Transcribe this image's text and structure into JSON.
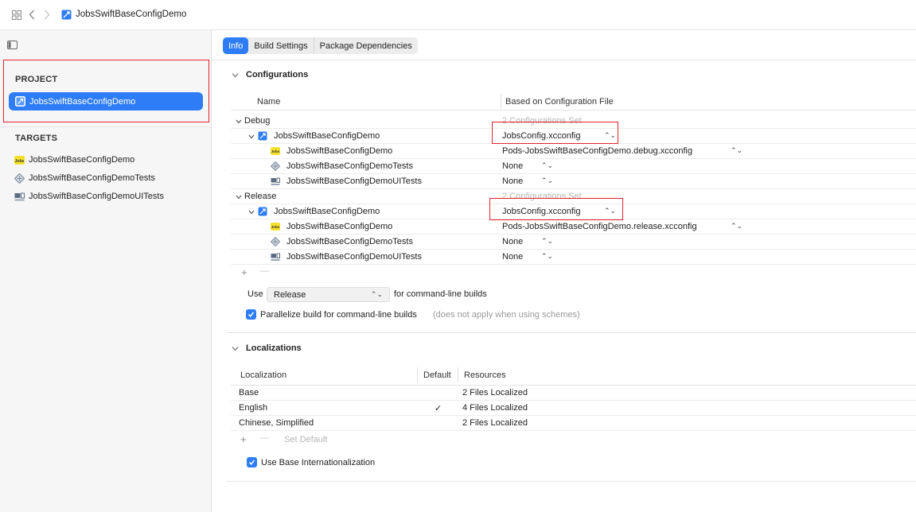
{
  "window": {
    "title": "JobsSwiftBaseConfigDemo"
  },
  "sidebar": {
    "project_header": "PROJECT",
    "project_item": "JobsSwiftBaseConfigDemo",
    "targets_header": "TARGETS",
    "targets": [
      {
        "label": "JobsSwiftBaseConfigDemo",
        "icon": "jobs-app-icon"
      },
      {
        "label": "JobsSwiftBaseConfigDemoTests",
        "icon": "unit-test-icon"
      },
      {
        "label": "JobsSwiftBaseConfigDemoUITests",
        "icon": "ui-test-icon"
      }
    ]
  },
  "tabs": [
    "Info",
    "Build Settings",
    "Package Dependencies"
  ],
  "configurations": {
    "title": "Configurations",
    "col_name": "Name",
    "col_based": "Based on Configuration File",
    "groups": [
      {
        "name": "Debug",
        "summary": "2 Configurations Set",
        "project": {
          "label": "JobsSwiftBaseConfigDemo",
          "value": "JobsConfig.xcconfig"
        },
        "targets": [
          {
            "label": "JobsSwiftBaseConfigDemo",
            "value": "Pods-JobsSwiftBaseConfigDemo.debug.xcconfig"
          },
          {
            "label": "JobsSwiftBaseConfigDemoTests",
            "value": "None"
          },
          {
            "label": "JobsSwiftBaseConfigDemoUITests",
            "value": "None"
          }
        ]
      },
      {
        "name": "Release",
        "summary": "2 Configurations Set",
        "project": {
          "label": "JobsSwiftBaseConfigDemo",
          "value": "JobsConfig.xcconfig"
        },
        "targets": [
          {
            "label": "JobsSwiftBaseConfigDemo",
            "value": "Pods-JobsSwiftBaseConfigDemo.release.xcconfig"
          },
          {
            "label": "JobsSwiftBaseConfigDemoTests",
            "value": "None"
          },
          {
            "label": "JobsSwiftBaseConfigDemoUITests",
            "value": "None"
          }
        ]
      }
    ],
    "use_label": "Use",
    "use_value": "Release",
    "use_suffix": "for command-line builds",
    "parallelize_label": "Parallelize build for command-line builds",
    "parallelize_note": "(does not apply when using schemes)",
    "parallelize_checked": true
  },
  "localizations": {
    "title": "Localizations",
    "col_localization": "Localization",
    "col_default": "Default",
    "col_resources": "Resources",
    "rows": [
      {
        "name": "Base",
        "default": "",
        "resources": "2 Files Localized"
      },
      {
        "name": "English",
        "default": "✓",
        "resources": "4 Files Localized"
      },
      {
        "name": "Chinese, Simplified",
        "default": "",
        "resources": "2 Files Localized"
      }
    ],
    "set_default": "Set Default",
    "use_base_label": "Use Base Internationalization",
    "use_base_checked": true
  },
  "symbols": {
    "plus": "+",
    "minus": "—",
    "updown": "⌃⌄"
  },
  "colors": {
    "accent": "#2e7df6",
    "highlight_box": "#e0242f"
  }
}
